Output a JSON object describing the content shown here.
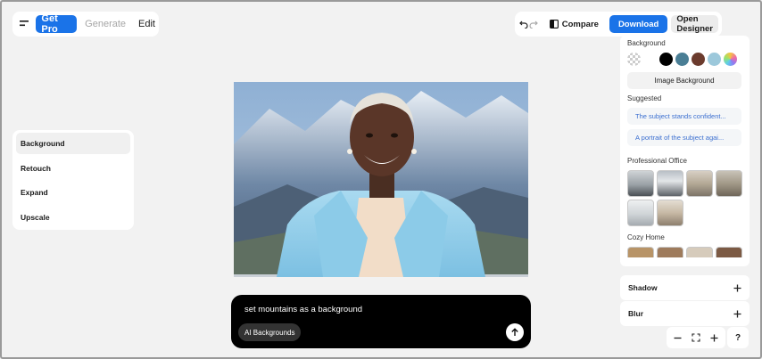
{
  "topbar_left": {
    "get_pro": "Get Pro",
    "generate": "Generate",
    "edit": "Edit"
  },
  "topbar_right": {
    "compare": "Compare",
    "download": "Download",
    "open_designer": "Open Designer"
  },
  "tools": {
    "items": [
      {
        "label": "Background",
        "active": true
      },
      {
        "label": "Retouch"
      },
      {
        "label": "Expand"
      },
      {
        "label": "Upscale"
      }
    ]
  },
  "prompt": {
    "text": "set mountains as a background",
    "chip": "AI Backgrounds"
  },
  "right_panel": {
    "background_title": "Background",
    "swatches": [
      "transparent",
      "#ffffff",
      "#000000",
      "#4a7e95",
      "#6b3b2d",
      "#9cc8db",
      "gradient"
    ],
    "image_background": "Image Background",
    "suggested_title": "Suggested",
    "suggestions": [
      "The subject stands confident...",
      "A portrait of the subject agai..."
    ],
    "professional_office_title": "Professional Office",
    "cozy_home_title": "Cozy Home"
  },
  "accordions": {
    "shadow": "Shadow",
    "blur": "Blur"
  },
  "help": "?"
}
